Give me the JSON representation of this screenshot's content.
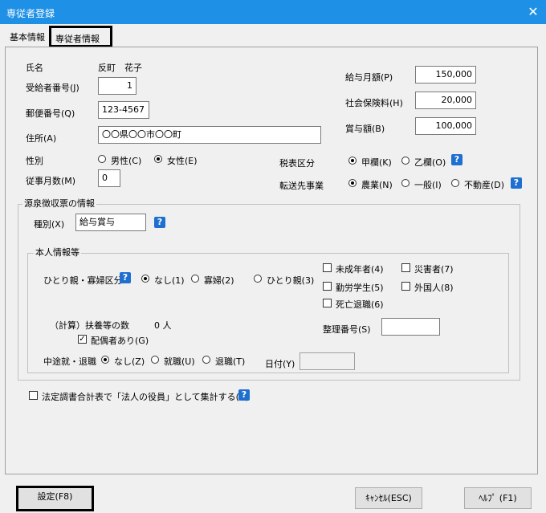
{
  "window": {
    "title": "専従者登録",
    "close_glyph": "✕"
  },
  "tabs": [
    {
      "label": "基本情報"
    },
    {
      "label": "専従者情報"
    }
  ],
  "person": {
    "name_label": "氏名",
    "name_value": "反町　花子",
    "recipient_no_label": "受給者番号(J)",
    "recipient_no_value": "1",
    "postal_label": "郵便番号(Q)",
    "postal_value": "123-4567",
    "address_label": "住所(A)",
    "address_value": "〇〇県〇〇市〇〇町",
    "gender_label": "性別",
    "gender_male": "男性(C)",
    "gender_female": "女性(E)",
    "gender_selected": "female",
    "months_label": "従事月数(M)",
    "months_value": "0"
  },
  "pay": {
    "monthly_label": "給与月額(P)",
    "monthly_value": "150,000",
    "social_label": "社会保険料(H)",
    "social_value": "20,000",
    "bonus_label": "賞与額(B)",
    "bonus_value": "100,000"
  },
  "tax": {
    "column_label": "税表区分",
    "column_kou": "甲欄(K)",
    "column_otsu": "乙欄(O)",
    "transfer_label": "転送先事業",
    "transfer_farm": "農業(N)",
    "transfer_general": "一般(I)",
    "transfer_realestate": "不動産(D)"
  },
  "withholding": {
    "group_label": "源泉徴収票の情報",
    "type_label": "種別(X)",
    "type_value": "給与賞与",
    "self_group_label": "本人情報等",
    "single_parent_label": "ひとり親・寡婦区分",
    "opt_none": "なし(1)",
    "opt_widow": "寡婦(2)",
    "opt_single": "ひとり親(3)",
    "minor": "未成年者(4)",
    "disaster": "災害者(7)",
    "working_student": "勤労学生(5)",
    "foreigner": "外国人(8)",
    "death_retire": "死亡退職(6)",
    "calc_label": "（計算）",
    "dependents_label": "扶養等の数",
    "dependents_value": "0 人",
    "spouse_label": "配偶者あり(G)",
    "ref_no_label": "整理番号(S)",
    "midterm_label": "中途就・退職",
    "mid_none": "なし(Z)",
    "mid_join": "就職(U)",
    "mid_retire": "退職(T)",
    "date_label": "日付(Y)"
  },
  "statutory": {
    "label": "法定調書合計表で「法人の役員」として集計する(R)"
  },
  "help_glyph": "?",
  "buttons": {
    "ok": "設定(F8)",
    "cancel": "ｷｬﾝｾﾙ(ESC)",
    "help": "ﾍﾙﾌﾟ (F1)"
  }
}
